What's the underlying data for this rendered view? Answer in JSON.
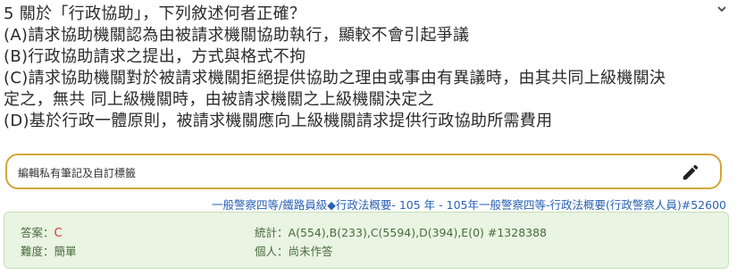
{
  "question": {
    "title": "5 關於「行政協助」，下列敘述何者正確？",
    "options": [
      "(A)請求協助機關認為由被請求機關協助執行，顯較不會引起爭議",
      "(B)行政協助請求之提出，方式與格式不拘",
      "(C)請求協助機關對於被請求機關拒絕提供協助之理由或事由有異議時，由其共同上級機關決",
      "定之，無共 同上級機關時，由被請求機關之上級機關決定之",
      "(D)基於行政一體原則，被請求機關應向上級機關請求提供行政協助所需費用"
    ]
  },
  "note": {
    "placeholder": "編輯私有筆記及自訂標籤"
  },
  "source_link": "一般警察四等/鐵路員級◆行政法概要- 105 年 - 105年一般警察四等-行政法概要(行政警察人員)#52600",
  "answer_panel": {
    "answer_label": "答案：",
    "answer_value": "C",
    "difficulty_label": "難度：",
    "difficulty_value": "簡單",
    "stats_label": "統計：",
    "stats_value": "A(554),B(233),C(5594),D(394),E(0) #1328388",
    "personal_label": "個人：",
    "personal_value": "尚未作答"
  },
  "colors": {
    "accent_border": "#d4a63a",
    "link": "#2a62b3",
    "panel_bg": "#e9f4e3",
    "answer_red": "#d9342b"
  },
  "icons": [
    "chevron-down-icon",
    "pencil-icon"
  ]
}
